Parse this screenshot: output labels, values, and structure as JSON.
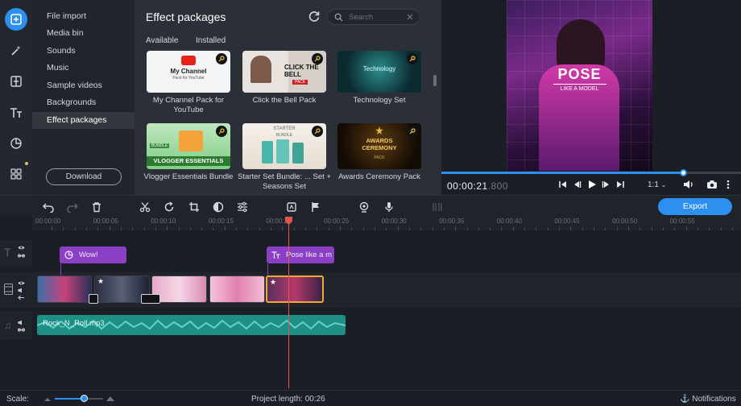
{
  "menu": {
    "items": [
      {
        "label": "File import"
      },
      {
        "label": "Media bin"
      },
      {
        "label": "Sounds"
      },
      {
        "label": "Music"
      },
      {
        "label": "Sample videos"
      },
      {
        "label": "Backgrounds"
      },
      {
        "label": "Effect packages",
        "active": true
      }
    ],
    "download_label": "Download"
  },
  "panel": {
    "title": "Effect packages",
    "search_placeholder": "Search",
    "tabs": [
      "Available",
      "Installed"
    ],
    "cards": [
      {
        "label": "My Channel Pack for YouTube",
        "thumb_text": "My Channel",
        "thumb_sub": "Pack for YouTube"
      },
      {
        "label": "Click the Bell Pack",
        "thumb_text": "CLICK THE BELL",
        "thumb_sub": "PACK"
      },
      {
        "label": "Technology Set",
        "thumb_text": "Technology",
        "thumb_sub": ""
      },
      {
        "label": "Vlogger Essentials Bundle",
        "thumb_text": "VLOGGER ESSENTIALS",
        "thumb_sub": "BUNDLE"
      },
      {
        "label": "Starter Set Bundle: ... Set + Seasons Set",
        "thumb_text": "STARTER",
        "thumb_sub": "BUNDLE"
      },
      {
        "label": "Awards Ceremony Pack",
        "thumb_text": "AWARDS CEREMONY",
        "thumb_sub": "PACK"
      }
    ]
  },
  "preview": {
    "video_title": "POSE",
    "video_subtitle": "LIKE A MODEL",
    "timecode_main": "00:00:21",
    "timecode_ms": ".800",
    "ratio": "1:1",
    "progress_fraction": 0.81
  },
  "toolbar": {
    "export_label": "Export"
  },
  "timeline": {
    "ruler_labels": [
      "00:00:00",
      "00:00:05",
      "00:00:10",
      "00:00:15",
      "00:00:20",
      "00:00:25",
      "00:00:30",
      "00:00:35",
      "00:00:40",
      "00:00:45",
      "00:00:50",
      "00:00:55"
    ],
    "title_clips": [
      {
        "label": "Wow!"
      },
      {
        "label": "Pose like a m"
      }
    ],
    "audio_clip_label": "Rock_N_Roll.mp3"
  },
  "status": {
    "scale_label": "Scale:",
    "project_length": "Project length:  00:26",
    "notifications": "Notifications"
  },
  "colors": {
    "accent": "#2d8ff0",
    "title_clip": "#8b3fc5",
    "audio_clip": "#1f8f85",
    "selected_clip_border": "#f0a92a",
    "playhead": "#e0584a"
  }
}
